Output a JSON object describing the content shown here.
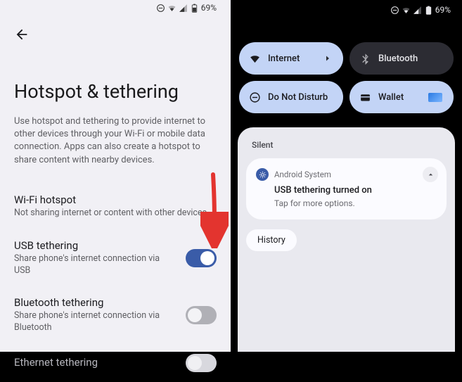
{
  "status": {
    "battery": "69%"
  },
  "settings": {
    "title": "Hotspot & tethering",
    "desc": "Use hotspot and tethering to provide internet to other devices through your Wi-Fi or mobile data connection. Apps can also create a hotspot to share content with nearby devices.",
    "items": {
      "wifi": {
        "title": "Wi-Fi hotspot",
        "sub": "Not sharing internet or content with other devices"
      },
      "usb": {
        "title": "USB tethering",
        "sub": "Share phone's internet connection via USB"
      },
      "bluetooth": {
        "title": "Bluetooth tethering",
        "sub": "Share phone's internet connection via Bluetooth"
      },
      "ethernet": {
        "title": "Ethernet tethering",
        "sub": ""
      }
    }
  },
  "shade": {
    "tiles": {
      "internet": "Internet",
      "bluetooth": "Bluetooth",
      "dnd": "Do Not Disturb",
      "wallet": "Wallet"
    },
    "silent_label": "Silent",
    "notif": {
      "app": "Android System",
      "title": "USB tethering turned on",
      "sub": "Tap for more options."
    },
    "history": "History"
  }
}
